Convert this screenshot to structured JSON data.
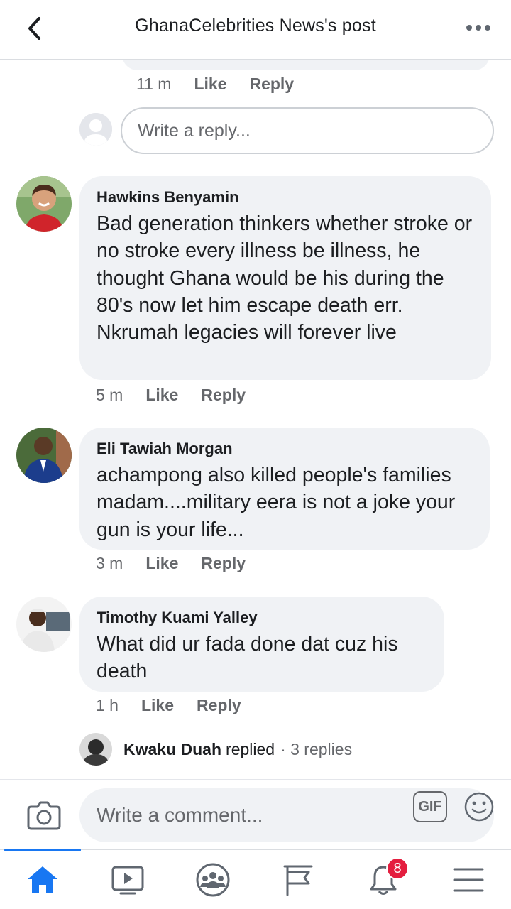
{
  "header": {
    "title": "GhanaCelebrities News's post"
  },
  "previous_comment": {
    "time": "11 m",
    "like": "Like",
    "reply": "Reply"
  },
  "reply_box": {
    "placeholder": "Write a reply..."
  },
  "comments": [
    {
      "author": "Hawkins Benyamin",
      "text": "Bad generation thinkers whether stroke or no stroke every illness be illness, he thought Ghana would be his during the 80's now let him escape death err. Nkrumah legacies will forever live",
      "time": "5 m",
      "like": "Like",
      "reply": "Reply"
    },
    {
      "author": "Eli Tawiah Morgan",
      "text": "achampong also killed people's families madam....military eera is not a joke your gun is your life...",
      "time": "3 m",
      "like": "Like",
      "reply": "Reply"
    },
    {
      "author": "Timothy Kuami Yalley",
      "text": "What did ur fada done dat cuz his death",
      "time": "1 h",
      "like": "Like",
      "reply": "Reply"
    }
  ],
  "replies_summary": {
    "name": "Kwaku Duah",
    "action": "replied",
    "count": "· 3 replies"
  },
  "composer": {
    "placeholder": "Write a comment...",
    "gif_label": "GIF"
  },
  "tabbar": {
    "active": "home",
    "notifications_badge": "8"
  },
  "colors": {
    "accent": "#1877f2",
    "bubble": "#f0f2f5",
    "secondary_text": "#65676b",
    "badge": "#e41e3f"
  }
}
